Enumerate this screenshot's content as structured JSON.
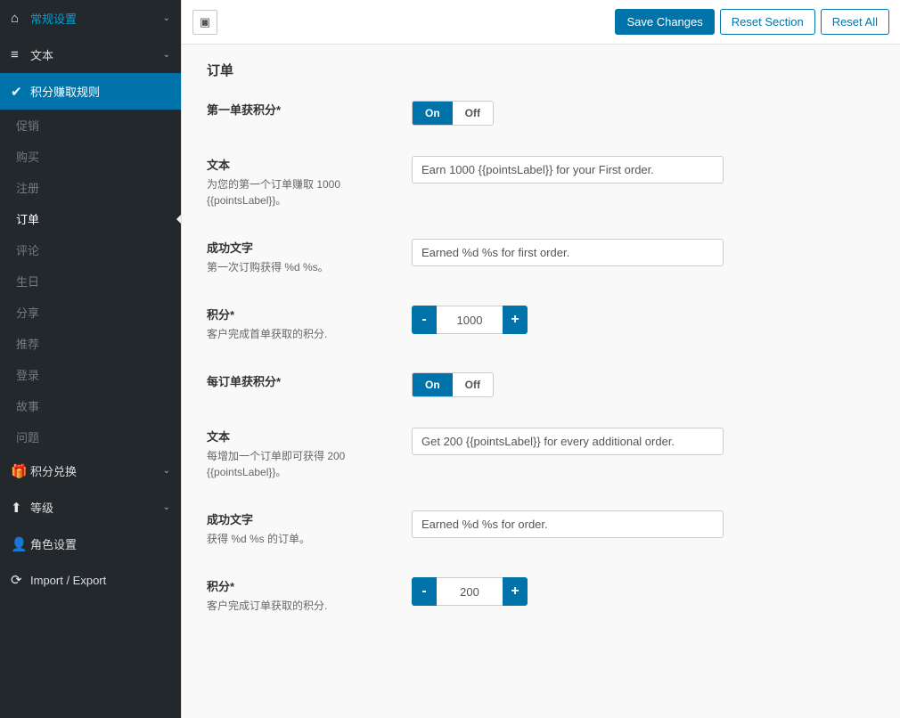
{
  "sidebar": {
    "items": [
      {
        "icon": "⌂",
        "label": "常规设置",
        "chev": true
      },
      {
        "icon": "≡",
        "label": "文本",
        "chev": true
      },
      {
        "icon": "✔",
        "label": "积分赚取规则",
        "chev": false,
        "active": true,
        "subs": [
          {
            "label": "促销"
          },
          {
            "label": "购买"
          },
          {
            "label": "注册"
          },
          {
            "label": "订单",
            "selected": true
          },
          {
            "label": "评论"
          },
          {
            "label": "生日"
          },
          {
            "label": "分享"
          },
          {
            "label": "推荐"
          },
          {
            "label": "登录"
          },
          {
            "label": "故事"
          },
          {
            "label": "问题"
          }
        ]
      },
      {
        "icon": "🎁",
        "label": "积分兑换",
        "chev": true
      },
      {
        "icon": "⬆",
        "label": "等级",
        "chev": true
      },
      {
        "icon": "👤",
        "label": "角色设置",
        "chev": false
      },
      {
        "icon": "⟳",
        "label": "Import / Export",
        "chev": false
      }
    ]
  },
  "topbar": {
    "save": "Save Changes",
    "resetSection": "Reset Section",
    "resetAll": "Reset All"
  },
  "page": {
    "title": "订单",
    "fields": {
      "firstPointsToggle": {
        "label": "第一单获积分*",
        "on": "On",
        "off": "Off",
        "value": "on"
      },
      "firstText": {
        "label": "文本",
        "desc": "为您的第一个订单赚取 1000 {{pointsLabel}}。",
        "value": "Earn 1000 {{pointsLabel}} for your First order."
      },
      "firstSuccess": {
        "label": "成功文字",
        "desc": "第一次订购获得 %d %s。",
        "value": "Earned %d %s for first order."
      },
      "firstPoints": {
        "label": "积分*",
        "desc": "客户完成首单获取的积分.",
        "value": "1000"
      },
      "everyToggle": {
        "label": "每订单获积分*",
        "on": "On",
        "off": "Off",
        "value": "on"
      },
      "everyText": {
        "label": "文本",
        "desc": "每增加一个订单即可获得 200 {{pointsLabel}}。",
        "value": "Get 200 {{pointsLabel}} for every additional order."
      },
      "everySuccess": {
        "label": "成功文字",
        "desc": "获得 %d %s 的订单。",
        "value": "Earned %d %s for order."
      },
      "everyPoints": {
        "label": "积分*",
        "desc": "客户完成订单获取的积分.",
        "value": "200"
      }
    }
  }
}
